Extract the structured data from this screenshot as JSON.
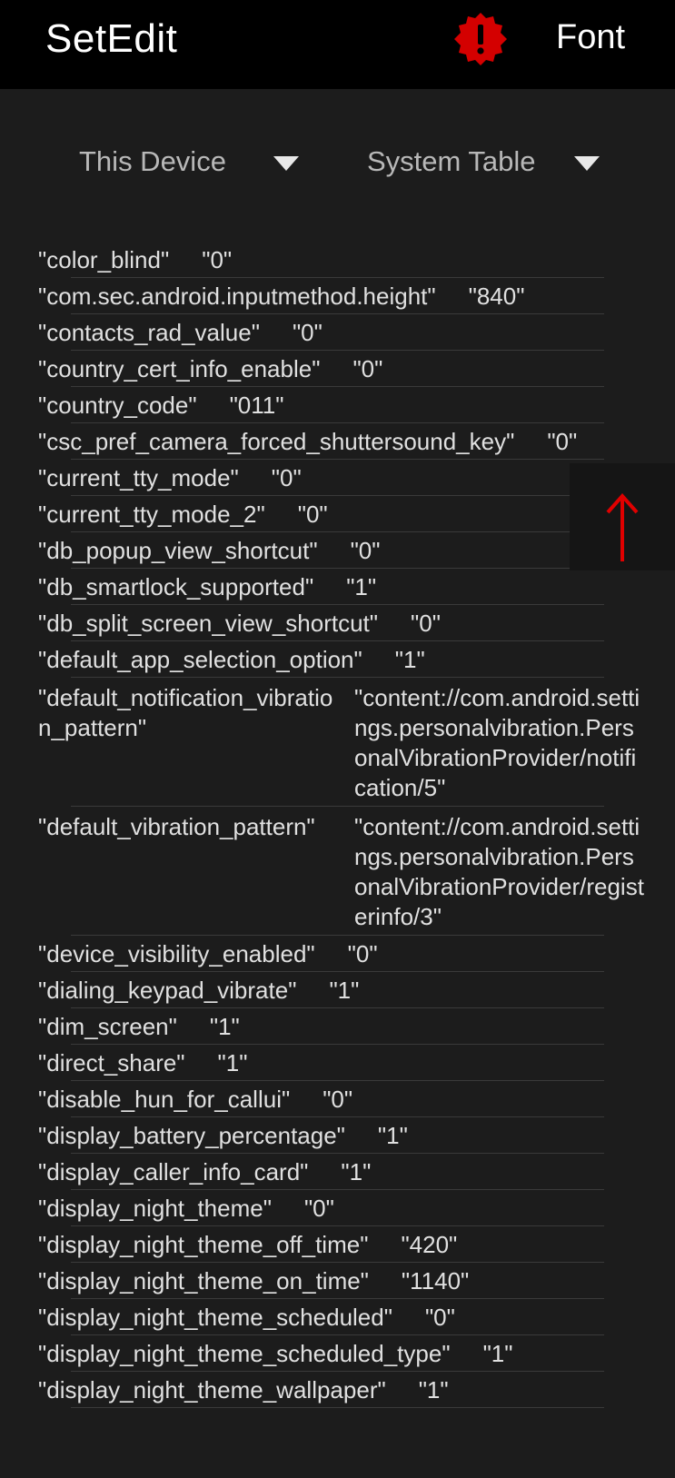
{
  "appbar": {
    "title": "SetEdit",
    "font_label": "Font",
    "alert_icon": "alert-badge-icon"
  },
  "selectors": {
    "device": "This Device",
    "table": "System Table"
  },
  "rows": [
    {
      "key": "\"color_blind\"",
      "value": "\"0\""
    },
    {
      "key": "\"com.sec.android.inputmethod.height\"",
      "value": "\"840\""
    },
    {
      "key": "\"contacts_rad_value\"",
      "value": "\"0\""
    },
    {
      "key": "\"country_cert_info_enable\"",
      "value": "\"0\""
    },
    {
      "key": "\"country_code\"",
      "value": "\"011\""
    },
    {
      "key": "\"csc_pref_camera_forced_shuttersound_key\"",
      "value": "\"0\""
    },
    {
      "key": "\"current_tty_mode\"",
      "value": "\"0\""
    },
    {
      "key": "\"current_tty_mode_2\"",
      "value": "\"0\""
    },
    {
      "key": "\"db_popup_view_shortcut\"",
      "value": "\"0\""
    },
    {
      "key": "\"db_smartlock_supported\"",
      "value": "\"1\""
    },
    {
      "key": "\"db_split_screen_view_shortcut\"",
      "value": "\"0\""
    },
    {
      "key": "\"default_app_selection_option\"",
      "value": "\"1\""
    },
    {
      "key": "\"default_notification_vibration_pattern\"",
      "value": "\"content://com.android.settings.personalvibration.PersonalVibrationProvider/notification/5\""
    },
    {
      "key": "\"default_vibration_pattern\"",
      "value": "\"content://com.android.settings.personalvibration.PersonalVibrationProvider/registerinfo/3\""
    },
    {
      "key": "\"device_visibility_enabled\"",
      "value": "\"0\""
    },
    {
      "key": "\"dialing_keypad_vibrate\"",
      "value": "\"1\""
    },
    {
      "key": "\"dim_screen\"",
      "value": "\"1\""
    },
    {
      "key": "\"direct_share\"",
      "value": "\"1\""
    },
    {
      "key": "\"disable_hun_for_callui\"",
      "value": "\"0\""
    },
    {
      "key": "\"display_battery_percentage\"",
      "value": "\"1\""
    },
    {
      "key": "\"display_caller_info_card\"",
      "value": "\"1\""
    },
    {
      "key": "\"display_night_theme\"",
      "value": "\"0\""
    },
    {
      "key": "\"display_night_theme_off_time\"",
      "value": "\"420\""
    },
    {
      "key": "\"display_night_theme_on_time\"",
      "value": "\"1140\""
    },
    {
      "key": "\"display_night_theme_scheduled\"",
      "value": "\"0\""
    },
    {
      "key": "\"display_night_theme_scheduled_type\"",
      "value": "\"1\""
    },
    {
      "key": "\"display_night_theme_wallpaper\"",
      "value": "\"1\""
    }
  ],
  "scroll_button": {
    "icon": "arrow-up-icon",
    "color": "#e00000"
  },
  "colors": {
    "appbar": "#000000",
    "background": "#1c1c1c",
    "alert": "#d40000"
  }
}
